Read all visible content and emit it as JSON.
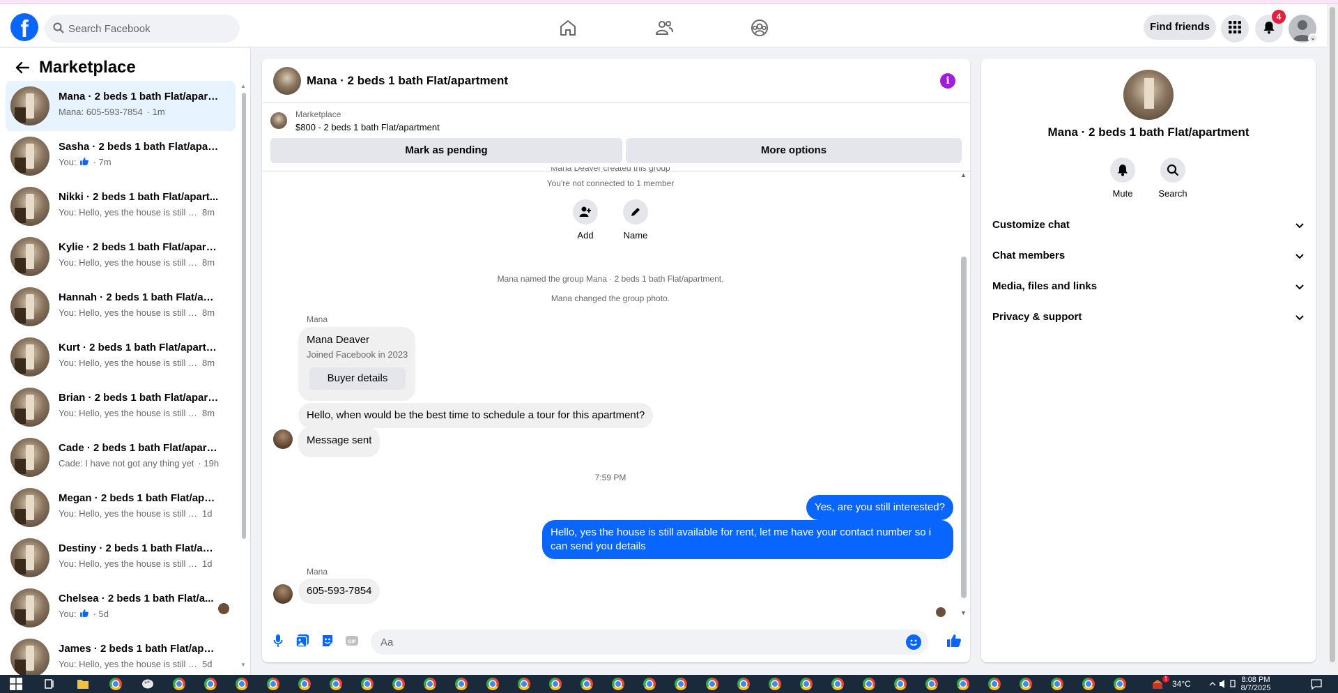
{
  "header": {
    "logo": "f",
    "search_placeholder": "Search Facebook",
    "nav_icons": [
      "home-icon",
      "friends-icon",
      "groups-icon"
    ],
    "find_friends": "Find friends",
    "notification_count": "4",
    "colors": {
      "brand": "#0866ff",
      "badge": "#e41e3f"
    }
  },
  "sidebar": {
    "title": "Marketplace",
    "conversations": [
      {
        "name": "Mana · 2 beds 1 bath Flat/apart...",
        "preview": "Mana: 605-593-7854",
        "time": "· 1m",
        "active": true
      },
      {
        "name": "Sasha · 2 beds 1 bath Flat/apart...",
        "preview": "You:",
        "time": "· 7m",
        "like": true
      },
      {
        "name": "Nikki · 2 beds 1 bath Flat/apart...",
        "preview": "You: Hello, yes the house is still av...",
        "time": "8m"
      },
      {
        "name": "Kylie · 2 beds 1 bath Flat/apartm...",
        "preview": "You: Hello, yes the house is still av...",
        "time": "8m"
      },
      {
        "name": "Hannah · 2 beds 1 bath Flat/apar...",
        "preview": "You: Hello, yes the house is still av...",
        "time": "8m"
      },
      {
        "name": "Kurt · 2 beds 1 bath Flat/apartm...",
        "preview": "You: Hello, yes the house is still av...",
        "time": "8m"
      },
      {
        "name": "Brian · 2 beds 1 bath Flat/apart...",
        "preview": "You: Hello, yes the house is still av...",
        "time": "8m"
      },
      {
        "name": "Cade · 2 beds 1 bath Flat/apartm...",
        "preview": "Cade: I have not got any thing yet",
        "time": "· 19h"
      },
      {
        "name": "Megan · 2 beds 1 bath Flat/apart...",
        "preview": "You: Hello, yes the house is still ava...",
        "time": "1d"
      },
      {
        "name": "Destiny · 2 beds 1 bath Flat/apar...",
        "preview": "You: Hello, yes the house is still ava...",
        "time": "1d"
      },
      {
        "name": "Chelsea · 2 beds 1 bath Flat/a...",
        "preview": "You:",
        "time": "· 5d",
        "like": true,
        "seen": true
      },
      {
        "name": "James · 2 beds 1 bath Flat/apart...",
        "preview": "You: Hello, yes the house is still ava...",
        "time": "5d"
      }
    ]
  },
  "chat": {
    "title": "Mana · 2 beds 1 bath Flat/apartment",
    "listing_label": "Marketplace",
    "listing_price": "$800 - 2 beds 1 bath Flat/apartment",
    "mark_pending": "Mark as pending",
    "more_options": "More options",
    "created_note": "Mana Deaver created this group",
    "not_connected": "You're not connected to 1 member",
    "actions": {
      "add": "Add",
      "name": "Name"
    },
    "named_note": "Mana named the group Mana · 2 beds 1 bath Flat/apartment.",
    "photo_note": "Mana changed the group photo.",
    "sender_name": "Mana",
    "card": {
      "name": "Mana Deaver",
      "joined": "Joined Facebook in 2023",
      "button": "Buyer details"
    },
    "msg_question": "Hello, when would be the best time to schedule a tour for this apartment?",
    "msg_sent": "Message sent",
    "timestamp": "7:59 PM",
    "my_msg_1": "Yes, are you still interested?",
    "my_msg_2": "Hello, yes the house is still available for rent, let me have your contact number so i can send you details",
    "msg_phone": "605-593-7854",
    "composer_placeholder": "Aa"
  },
  "info": {
    "title": "Mana · 2 beds 1 bath Flat/apartment",
    "mute": "Mute",
    "search": "Search",
    "sections": [
      "Customize chat",
      "Chat members",
      "Media, files and links",
      "Privacy & support"
    ]
  },
  "taskbar": {
    "temperature": "34°C",
    "time": "8:08 PM",
    "date": "8/7/2025",
    "badge": "1"
  }
}
